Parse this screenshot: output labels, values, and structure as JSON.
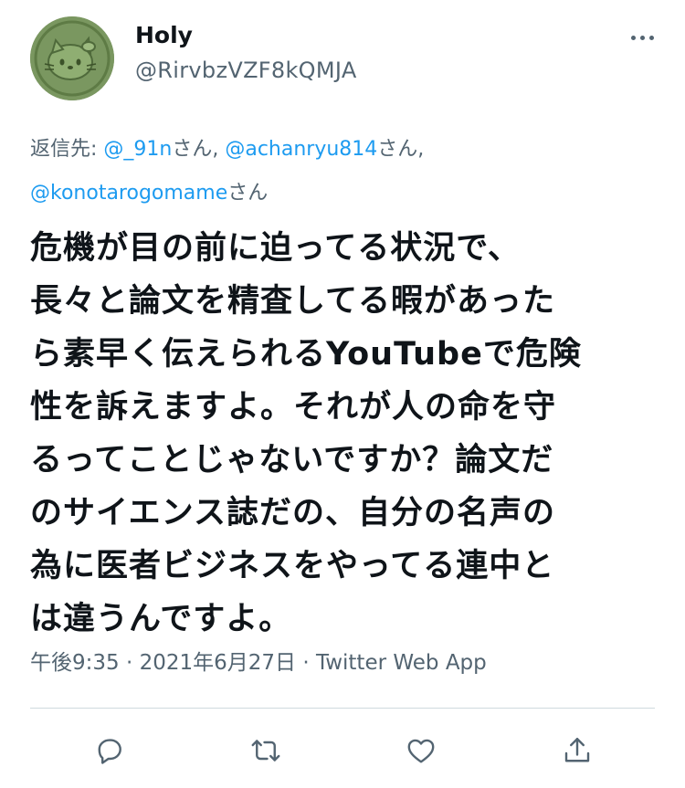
{
  "user": {
    "display_name": "Holy",
    "handle": "@RirvbzVZF8kQMJA"
  },
  "reply": {
    "prefix": "返信先: ",
    "mention1": "@_91n",
    "suffix1": "さん, ",
    "mention2": "@achanryu814",
    "suffix2": "さん,",
    "mention3": "@konotarogomame",
    "suffix3": "さん"
  },
  "tweet": {
    "lines": [
      "危機が目の前に迫ってる状況で、",
      "長々と論文を精査してる暇があった",
      "ら素早く伝えられるYouTubeで危険",
      "性を訴えますよ。それが人の命を守",
      "るってことじゃないですか？論文だ",
      "のサイエンス誌だの、自分の名声の",
      "為に医者ビジネスをやってる連中と",
      "は違うんですよ。"
    ]
  },
  "meta": {
    "time": "午後9:35",
    "sep1": " · ",
    "date": "2021年6月27日",
    "sep2": " · ",
    "source": "Twitter Web App"
  },
  "icons": {
    "more": "more-dots-icon",
    "reply": "reply-bubble-icon",
    "retweet": "retweet-icon",
    "like": "heart-icon",
    "share": "share-upload-icon"
  },
  "colors": {
    "text": "#0f1419",
    "secondary": "#536471",
    "link": "#1d9bf0",
    "divider": "#cfd9de"
  }
}
